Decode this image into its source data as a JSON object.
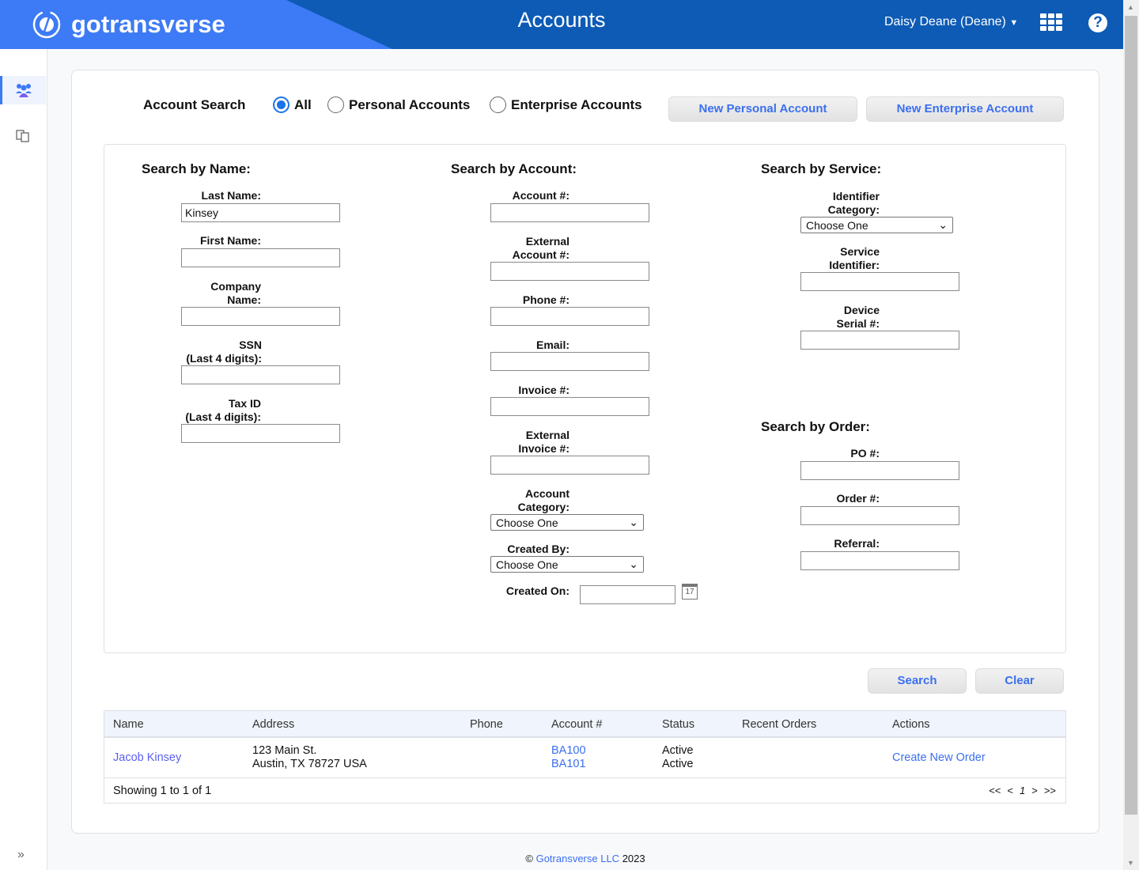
{
  "header": {
    "logo": "gotransverse",
    "title": "Accounts",
    "user": "Daisy Deane (Deane)",
    "icons": [
      "apps-grid-icon",
      "help-icon"
    ]
  },
  "sidebar": {
    "items": [
      {
        "icon": "accounts-users-icon",
        "active": true
      },
      {
        "icon": "documents-icon",
        "active": false
      }
    ],
    "expand_icon": "double-chevron-right-icon"
  },
  "search": {
    "title": "Account Search",
    "radios": [
      {
        "label": "All",
        "checked": true
      },
      {
        "label": "Personal Accounts",
        "checked": false
      },
      {
        "label": "Enterprise Accounts",
        "checked": false
      }
    ],
    "new_personal": "New Personal Account",
    "new_enterprise": "New Enterprise Account"
  },
  "by_name": {
    "heading": "Search by Name:",
    "last_name": "Last Name:",
    "last_name_value": "Kinsey",
    "first_name": "First Name:",
    "company": "Company\nName:",
    "ssn": "SSN\n(Last 4 digits):",
    "tax_id": "Tax ID\n(Last 4 digits):"
  },
  "by_account": {
    "heading": "Search by Account:",
    "account_no": "Account #:",
    "external_account": "External\nAccount #:",
    "phone": "Phone #:",
    "email": "Email:",
    "invoice": "Invoice #:",
    "external_invoice": "External\nInvoice #:",
    "category": "Account\nCategory:",
    "category_value": "Choose One",
    "created_by": "Created By:",
    "created_by_value": "Choose One",
    "created_on": "Created On:",
    "calendar_icon": "calendar-icon",
    "calendar_day": "17"
  },
  "by_service": {
    "heading": "Search by Service:",
    "identifier_category": "Identifier\nCategory:",
    "identifier_category_value": "Choose One",
    "service_identifier": "Service\nIdentifier:",
    "device_serial": "Device\nSerial #:"
  },
  "by_order": {
    "heading": "Search by Order:",
    "po": "PO #:",
    "order": "Order #:",
    "referral": "Referral:"
  },
  "actions": {
    "search": "Search",
    "clear": "Clear"
  },
  "table": {
    "columns": [
      "Name",
      "Address",
      "Phone",
      "Account #",
      "Status",
      "Recent Orders",
      "Actions"
    ],
    "rows": [
      {
        "name": "Jacob Kinsey",
        "address_line1": "123 Main St.",
        "address_line2": "Austin, TX 78727 USA",
        "phone": "",
        "accounts": [
          "BA100",
          "BA101"
        ],
        "statuses": [
          "Active",
          "Active"
        ],
        "recent_orders": "",
        "action": "Create New Order"
      }
    ],
    "showing": "Showing 1 to 1 of 1",
    "pager": {
      "first": "<<",
      "prev": "<",
      "page": "1",
      "next": ">",
      "last": ">>"
    }
  },
  "footer": {
    "copyright": "©",
    "company": "Gotransverse LLC",
    "year": "2023"
  },
  "colors": {
    "header_dark": "#0d5bb5",
    "header_light": "#3d7af5",
    "link": "#3b6ff0"
  }
}
